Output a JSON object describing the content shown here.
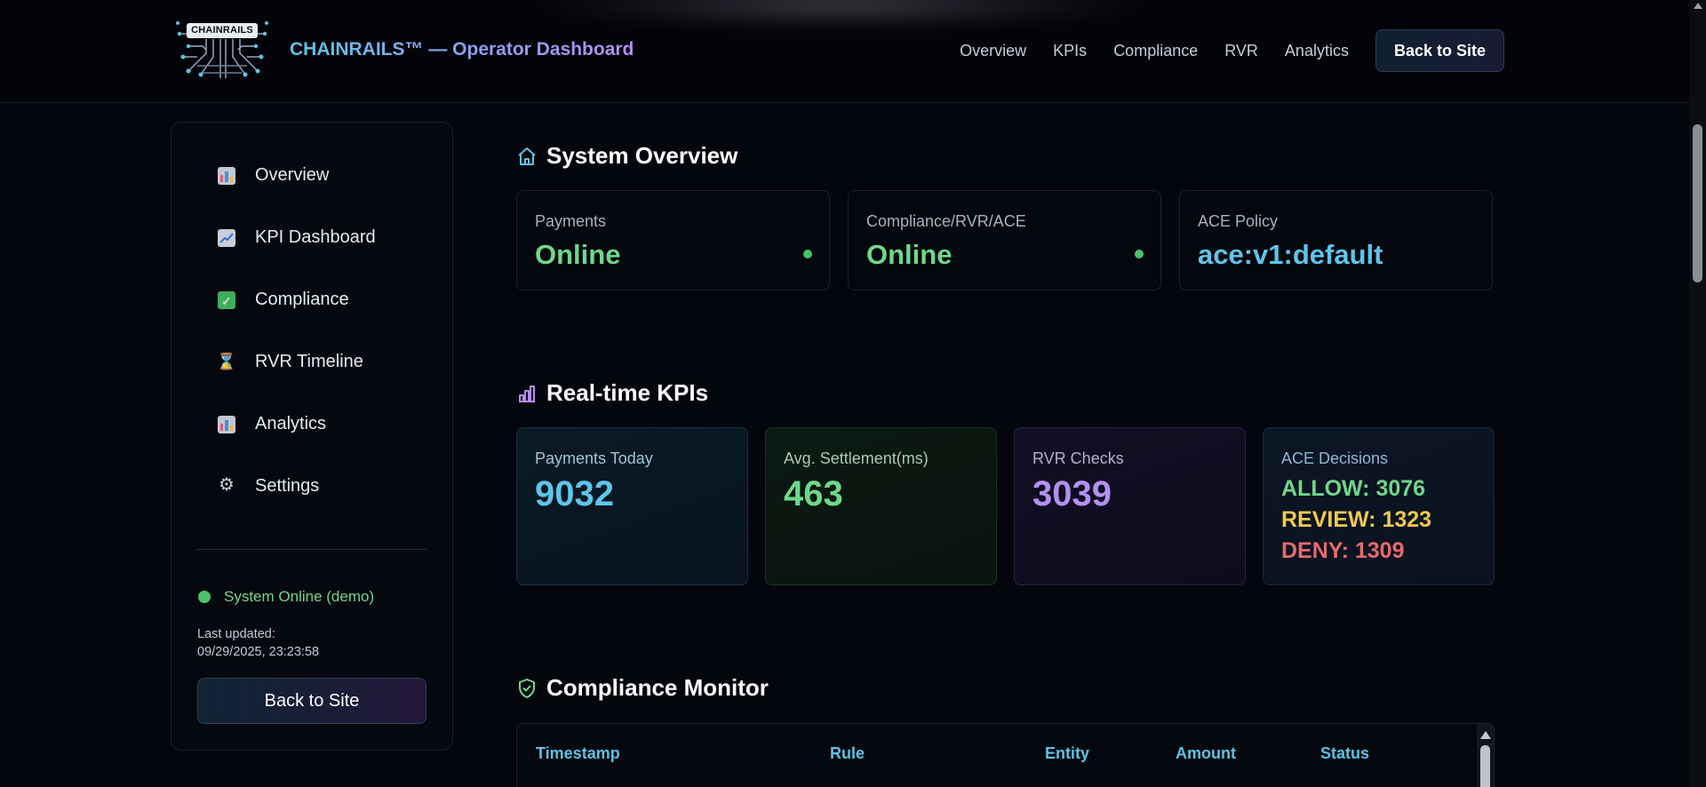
{
  "header": {
    "logo_text": "CHAINRAILS",
    "title": "CHAINRAILS™ — Operator Dashboard",
    "nav": [
      "Overview",
      "KPIs",
      "Compliance",
      "RVR",
      "Analytics"
    ],
    "back_button": "Back to Site"
  },
  "sidebar": {
    "items": [
      {
        "label": "Overview",
        "icon": "bar-chart-icon"
      },
      {
        "label": "KPI Dashboard",
        "icon": "line-chart-icon"
      },
      {
        "label": "Compliance",
        "icon": "checkbox-icon"
      },
      {
        "label": "RVR Timeline",
        "icon": "hourglass-icon"
      },
      {
        "label": "Analytics",
        "icon": "bar-chart-icon"
      },
      {
        "label": "Settings",
        "icon": "gear-icon"
      }
    ],
    "status": "System Online (demo)",
    "last_updated_label": "Last updated:",
    "last_updated_value": "09/29/2025, 23:23:58",
    "back_button": "Back to Site"
  },
  "overview": {
    "title": "System Overview",
    "cards": [
      {
        "label": "Payments",
        "value": "Online",
        "color": "#6fd88a"
      },
      {
        "label": "Compliance/RVR/ACE",
        "value": "Online",
        "color": "#6fd88a"
      },
      {
        "label": "ACE Policy",
        "value": "ace:v1:default",
        "color": "#5fc4ea"
      }
    ]
  },
  "kpis": {
    "title": "Real-time KPIs",
    "payments_today": {
      "label": "Payments Today",
      "value": "9032"
    },
    "avg_settlement": {
      "label": "Avg. Settlement(ms)",
      "value": "463"
    },
    "rvr_checks": {
      "label": "RVR Checks",
      "value": "3039"
    },
    "ace_decisions": {
      "label": "ACE Decisions",
      "allow": "ALLOW: 3076",
      "review": "REVIEW: 1323",
      "deny": "DENY: 1309"
    }
  },
  "compliance": {
    "title": "Compliance Monitor",
    "columns": [
      "Timestamp",
      "Rule",
      "Entity",
      "Amount",
      "Status"
    ]
  },
  "colors": {
    "accent_blue": "#5fc4e4",
    "accent_purple": "#b48ff0",
    "green": "#6fd88a",
    "yellow": "#f2c94c",
    "red": "#e86a6a"
  }
}
